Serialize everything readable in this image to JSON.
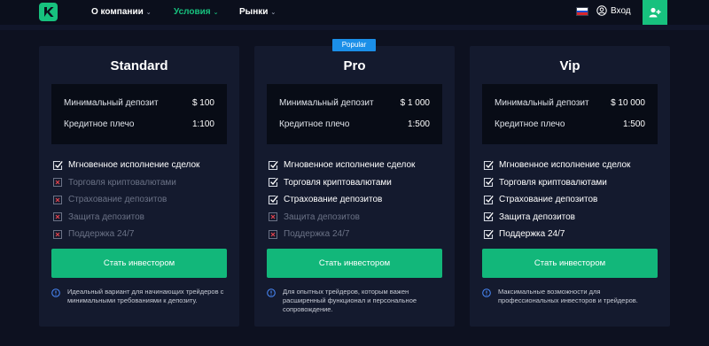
{
  "header": {
    "logo_icon": "k-logo-icon",
    "nav": [
      {
        "label": "О компании",
        "active": false
      },
      {
        "label": "Условия",
        "active": true
      },
      {
        "label": "Рынки",
        "active": false
      }
    ],
    "language_flag_icon": "russia-flag-icon",
    "login_label": "Вход",
    "register_icon": "add-user-icon",
    "accent_color": "#17c17e"
  },
  "badge": {
    "label": "Popular"
  },
  "plans": [
    {
      "title": "Standard",
      "deposit_label": "Минимальный депозит",
      "deposit_value": "$ 100",
      "leverage_label": "Кредитное плечо",
      "leverage_value": "1:100",
      "features": [
        {
          "label": "Мгновенное исполнение сделок",
          "included": true
        },
        {
          "label": "Торговля криптовалютами",
          "included": false
        },
        {
          "label": "Страхование депозитов",
          "included": false
        },
        {
          "label": "Защита депозитов",
          "included": false
        },
        {
          "label": "Поддержка 24/7",
          "included": false
        }
      ],
      "cta": "Стать инвестором",
      "note": "Идеальный вариант для начинающих трейдеров с минимальными требованиями к депозиту."
    },
    {
      "title": "Pro",
      "deposit_label": "Минимальный депозит",
      "deposit_value": "$ 1 000",
      "leverage_label": "Кредитное плечо",
      "leverage_value": "1:500",
      "features": [
        {
          "label": "Мгновенное исполнение сделок",
          "included": true
        },
        {
          "label": "Торговля криптовалютами",
          "included": true
        },
        {
          "label": "Страхование депозитов",
          "included": true
        },
        {
          "label": "Защита депозитов",
          "included": false
        },
        {
          "label": "Поддержка 24/7",
          "included": false
        }
      ],
      "cta": "Стать инвестором",
      "note": "Для опытных трейдеров, которым важен расширенный функционал и персональное сопровождение."
    },
    {
      "title": "Vip",
      "deposit_label": "Минимальный депозит",
      "deposit_value": "$ 10 000",
      "leverage_label": "Кредитное плечо",
      "leverage_value": "1:500",
      "features": [
        {
          "label": "Мгновенное исполнение сделок",
          "included": true
        },
        {
          "label": "Торговля криптовалютами",
          "included": true
        },
        {
          "label": "Страхование депозитов",
          "included": true
        },
        {
          "label": "Защита депозитов",
          "included": true
        },
        {
          "label": "Поддержка 24/7",
          "included": true
        }
      ],
      "cta": "Стать инвестором",
      "note": "Максимальные возможности для профессиональных инвесторов и трейдеров."
    }
  ]
}
